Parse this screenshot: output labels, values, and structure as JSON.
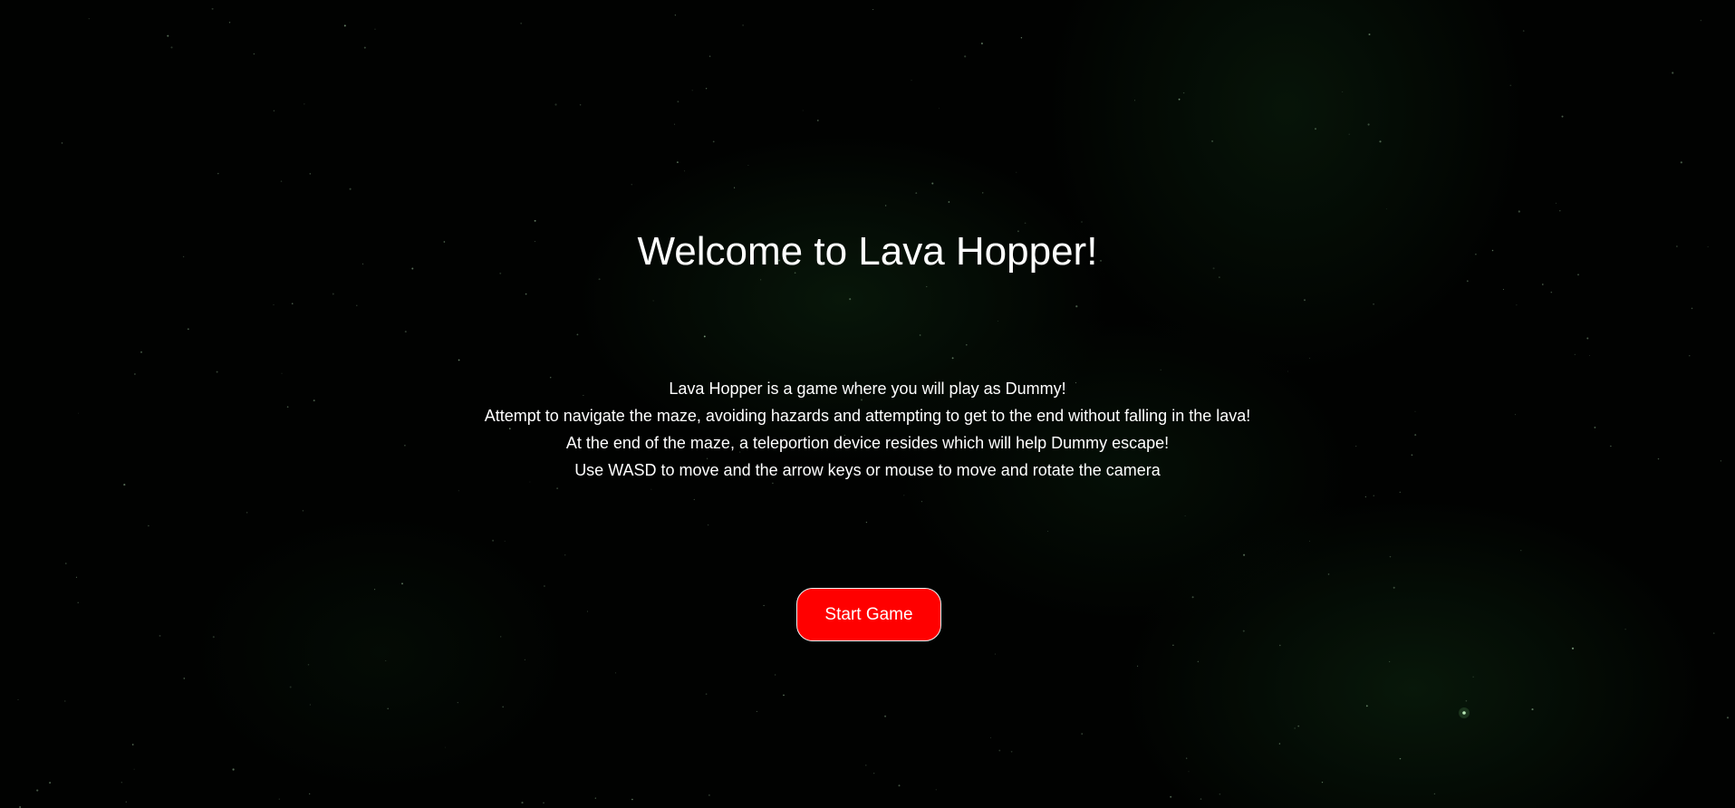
{
  "game": {
    "title": "Welcome to Lava Hopper!",
    "description": [
      "Lava Hopper is a game where you will play as Dummy!",
      "Attempt to navigate the maze, avoiding hazards and attempting to get to the end without falling in the lava!",
      "At the end of the maze, a teleportion device resides which will help Dummy escape!",
      "Use WASD to move and the arrow keys or mouse to move and rotate the camera"
    ],
    "start_button_label": "Start Game"
  },
  "colors": {
    "background": "#000000",
    "nebula": "#0f3a14",
    "text": "#ffffff",
    "button": "#ff0000",
    "button_border": "#f2f2f2"
  }
}
